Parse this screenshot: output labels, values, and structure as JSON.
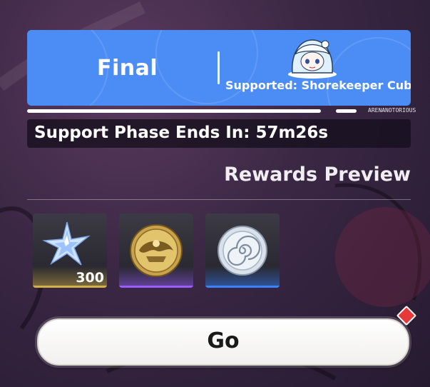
{
  "banner": {
    "title": "Final",
    "supported": "Supported: Shorekeeper Cube",
    "tiny_left": "ARENA",
    "tiny_right": "NOTORIOUS"
  },
  "timer": {
    "text": "Support Phase Ends In: 57m26s"
  },
  "rewards": {
    "title": "Rewards Preview",
    "items": [
      {
        "name": "crystal",
        "count": "300"
      },
      {
        "name": "gold-coin",
        "count": ""
      },
      {
        "name": "silver-shell-coin",
        "count": ""
      }
    ]
  },
  "action": {
    "go_label": "Go"
  },
  "colors": {
    "banner_blue": "#4b8df4",
    "purple_glow": "#9b5cff",
    "blue_glow": "#3b82ff",
    "gold_glow": "#d4b04a",
    "badge_red": "#e63a3a"
  }
}
